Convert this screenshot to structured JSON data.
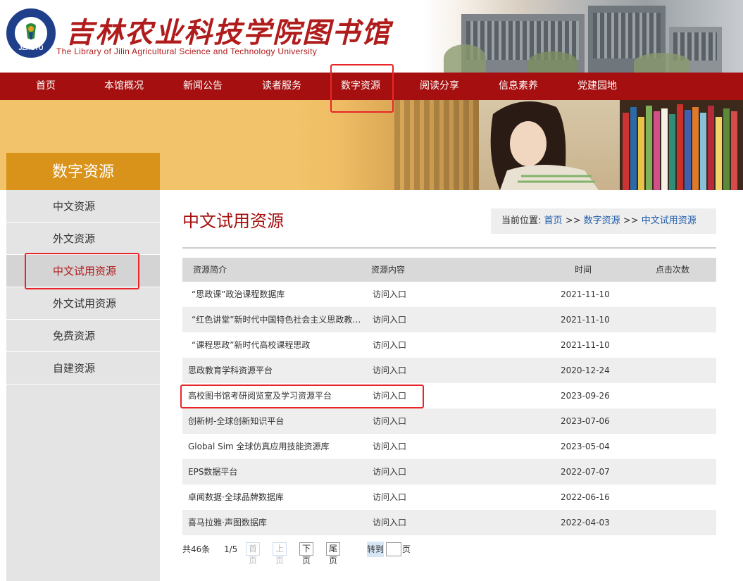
{
  "header": {
    "logo_text": "JLASTU",
    "title_cn": "吉林农业科技学院图书馆",
    "title_en": "The Library of Jilin Agricultural Science and Technology University"
  },
  "nav": {
    "items": [
      {
        "label": "首页"
      },
      {
        "label": "本馆概况"
      },
      {
        "label": "新闻公告"
      },
      {
        "label": "读者服务"
      },
      {
        "label": "数字资源"
      },
      {
        "label": "阅读分享"
      },
      {
        "label": "信息素养"
      },
      {
        "label": "党建园地"
      }
    ],
    "selected": "数字资源"
  },
  "sidebar": {
    "title": "数字资源",
    "items": [
      {
        "label": "中文资源"
      },
      {
        "label": "外文资源"
      },
      {
        "label": "中文试用资源"
      },
      {
        "label": "外文试用资源"
      },
      {
        "label": "免费资源"
      },
      {
        "label": "自建资源"
      }
    ],
    "active": "中文试用资源"
  },
  "main": {
    "title": "中文试用资源",
    "breadcrumb": {
      "prefix": "当前位置:",
      "home": "首页",
      "sep": ">>",
      "level1": "数字资源",
      "level2": "中文试用资源"
    },
    "table": {
      "headers": [
        "资源简介",
        "资源内容",
        "时间",
        "点击次数"
      ],
      "rows": [
        {
          "name": "“思政课”政治课程数据库",
          "content": "访问入口",
          "date": "2021-11-10",
          "clicks": ""
        },
        {
          "name": "“红色讲堂”新时代中国特色社会主义思政教…",
          "content": "访问入口",
          "date": "2021-11-10",
          "clicks": ""
        },
        {
          "name": "“课程思政”新时代高校课程思政",
          "content": "访问入口",
          "date": "2021-11-10",
          "clicks": ""
        },
        {
          "name": "思政教育学科资源平台",
          "content": "访问入口",
          "date": "2020-12-24",
          "clicks": ""
        },
        {
          "name": "高校图书馆考研阅览室及学习资源平台",
          "content": "访问入口",
          "date": "2023-09-26",
          "clicks": ""
        },
        {
          "name": "创新树-全球创新知识平台",
          "content": "访问入口",
          "date": "2023-07-06",
          "clicks": ""
        },
        {
          "name": "Global Sim 全球仿真应用技能资源库",
          "content": "访问入口",
          "date": "2023-05-04",
          "clicks": ""
        },
        {
          "name": "EPS数据平台",
          "content": "访问入口",
          "date": "2022-07-07",
          "clicks": ""
        },
        {
          "name": "卓闻数据·全球品牌数据库",
          "content": "访问入口",
          "date": "2022-06-16",
          "clicks": ""
        },
        {
          "name": "喜马拉雅·声图数据库",
          "content": "访问入口",
          "date": "2022-04-03",
          "clicks": ""
        }
      ]
    },
    "pager": {
      "total": "共46条",
      "page": "1/5",
      "first": "首页",
      "prev": "上页",
      "next": "下页",
      "last": "尾页",
      "goto": "转到",
      "goto_value": "",
      "unit": "页"
    }
  },
  "colors": {
    "nav_bg": "#a50f0f",
    "accent_red": "#b01c1c",
    "sidebar_title_bg": "#d9931a",
    "link_blue": "#1e5aa8",
    "highlight": "#e8262a"
  }
}
